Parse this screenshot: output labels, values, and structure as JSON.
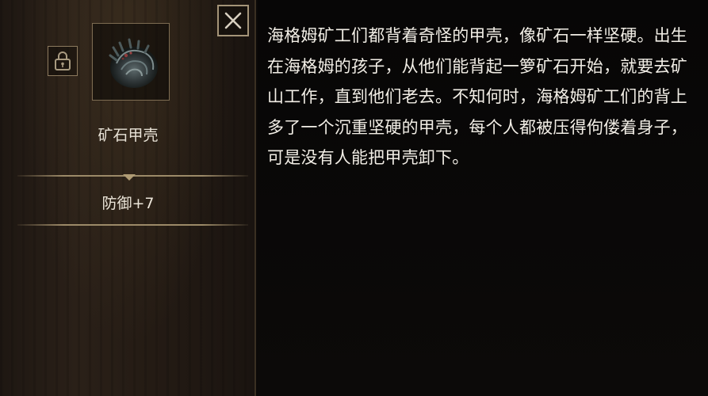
{
  "item": {
    "name": "矿石甲壳",
    "icon": "shell-armor-icon",
    "stat": "防御+7",
    "description": "海格姆矿工们都背着奇怪的甲壳，像矿石一样坚硬。出生在海格姆的孩子，从他们能背起一箩矿石开始，就要去矿山工作，直到他们老去。不知何时，海格姆矿工们的背上多了一个沉重坚硬的甲壳，每个人都被压得佝偻着身子，可是没有人能把甲壳卸下。"
  },
  "buttons": {
    "lock_icon": "lock-icon",
    "close_icon": "close-icon"
  },
  "colors": {
    "text": "#f2eee6",
    "frame": "#7d6c52",
    "accent": "#9c8a68"
  }
}
